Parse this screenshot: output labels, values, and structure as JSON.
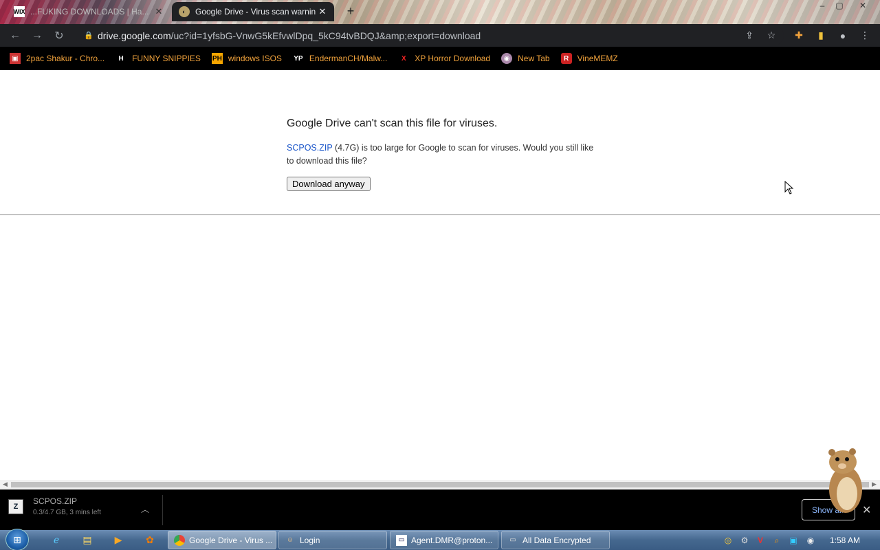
{
  "tabs": [
    {
      "favicon": "WIX",
      "title": "...FUKING DOWNLOADS | Ha..."
    },
    {
      "favicon": "gd",
      "title": "Google Drive - Virus scan warnin"
    }
  ],
  "window": {
    "minimize": "–",
    "restore": "▢",
    "close": "✕"
  },
  "address": {
    "host": "drive.google.com",
    "path": "/uc?id=1yfsbG-VnwG5kEfvwlDpq_5kC94tvBDQJ&amp;export=download"
  },
  "bookmarks": [
    {
      "label": "2pac Shakur - Chro...",
      "icon": "2pac-icon"
    },
    {
      "label": "FUNNY SNIPPIES",
      "icon": "h-icon"
    },
    {
      "label": "windows ISOS",
      "icon": "ph-icon"
    },
    {
      "label": "EndermanCH/Malw...",
      "icon": "yp-icon"
    },
    {
      "label": "XP Horror Download",
      "icon": "x-icon"
    },
    {
      "label": "New Tab",
      "icon": "globe-icon"
    },
    {
      "label": "VineMEMZ",
      "icon": "r-icon"
    }
  ],
  "page": {
    "title": "Google Drive can't scan this file for viruses.",
    "file_link": "SCPOS.ZIP",
    "body_rest": " (4.7G) is too large for Google to scan for viruses. Would you still like to download this file?",
    "button": "Download anyway"
  },
  "download": {
    "name": "SCPOS.ZIP",
    "status": "0.3/4.7 GB, 3 mins left",
    "show_all": "Show all"
  },
  "taskbar": {
    "tasks": [
      {
        "label": "Google Drive - Virus ..."
      },
      {
        "label": "Login"
      },
      {
        "label": "Agent.DMR@proton..."
      },
      {
        "label": "All Data Encrypted"
      }
    ],
    "clock": "1:58 AM"
  }
}
